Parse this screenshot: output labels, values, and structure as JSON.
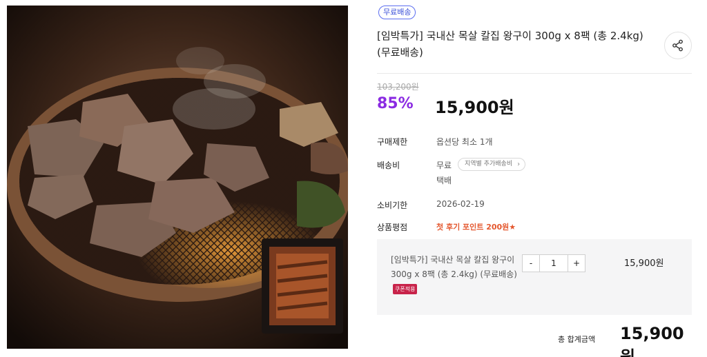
{
  "badge": "무료배송",
  "title": "[임박특가] 국내산 목살 칼집 왕구이 300g x 8팩 (총 2.4kg) (무료배송)",
  "original_price": "103,200원",
  "discount": "85%",
  "price": "15,900원",
  "details": {
    "purchase_limit_label": "구매제한",
    "purchase_limit_value": "옵션당 최소 1개",
    "shipping_label": "배송비",
    "shipping_value": "무료",
    "shipping_region_chip": "지역별 추가배송비",
    "shipping_method": "택배",
    "expiry_label": "소비기한",
    "expiry_value": "2026-02-19",
    "rating_label": "상품평점",
    "rating_value": "첫 후기 포인트 200원★"
  },
  "option": {
    "name": "[임박특가] 국내산 목살 칼집 왕구이 300g x 8팩 (총 2.4kg) (무료배송)",
    "coupon": "쿠폰적용",
    "minus": "-",
    "quantity": "1",
    "plus": "+",
    "price": "15,900원"
  },
  "total": {
    "label": "총 합계금액",
    "price": "15,900원"
  },
  "icons": {
    "share": "share-icon"
  },
  "colors": {
    "discount": "#8b2be2",
    "badge_border": "#5b6df0",
    "review": "#e4572e",
    "coupon": "#c8234a"
  }
}
